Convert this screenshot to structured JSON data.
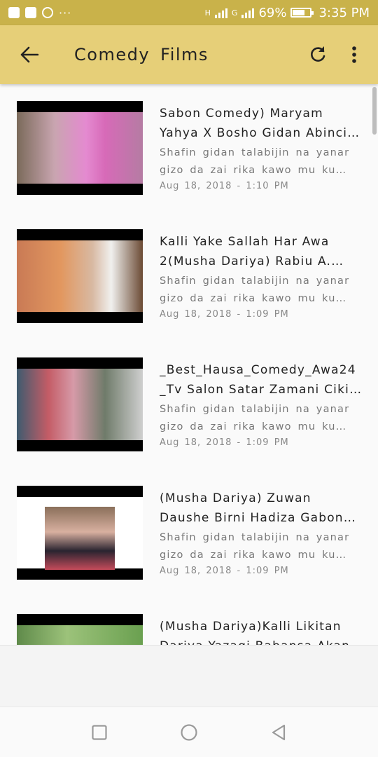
{
  "status_bar": {
    "notification_icons": [
      "facebook-icon",
      "gallery-icon",
      "hotspot-icon"
    ],
    "more": "···",
    "network1": "H",
    "network2": "G",
    "battery_percent": "69%",
    "battery_level": 0.69,
    "time": "3:35 PM"
  },
  "app_bar": {
    "title": "Comedy  Films",
    "back_icon": "arrow-back-icon",
    "refresh_icon": "refresh-icon",
    "menu_icon": "more-vert-icon",
    "background": "#e6cf78"
  },
  "videos": [
    {
      "title": "Sabon Comedy) Maryam Yahya X Bosho Gidan Abinci Mushadariya",
      "description": "Shafin gidan talabijin na yanar gizo da zai rika kawo mu ku kallon fina-finai",
      "date": "Aug 18, 2018 - 1:10 PM"
    },
    {
      "title": "Kalli Yake Sallah Har Awa 2(Musha Dariya) Rabiu A. Zango",
      "description": "Shafin gidan talabijin na yanar gizo da zai rika kawo mu ku kallon fina-finai",
      "date": "Aug 18, 2018 - 1:09 PM"
    },
    {
      "title": "_Best_Hausa_Comedy_Awa24 _Tv Salon Satar Zamani Cikin Gari",
      "description": "Shafin gidan talabijin na yanar gizo da zai rika kawo mu ku kallon fina-finai",
      "date": "Aug 18, 2018 - 1:09 PM"
    },
    {
      "title": "(Musha Dariya) Zuwan Daushe Birni Hadiza Gabon Video",
      "description": "Shafin gidan talabijin na yanar gizo da zai rika kawo mu ku kallon fina-finai",
      "date": "Aug 18, 2018 - 1:09 PM"
    },
    {
      "title": "(Musha Dariya)Kalli Likitan Dariya Yazagi Babansa Akan Yarinya",
      "description": "",
      "date": ""
    }
  ],
  "nav_bar": {
    "recents_icon": "square-recents-icon",
    "home_icon": "circle-home-icon",
    "back_icon": "triangle-back-icon"
  }
}
